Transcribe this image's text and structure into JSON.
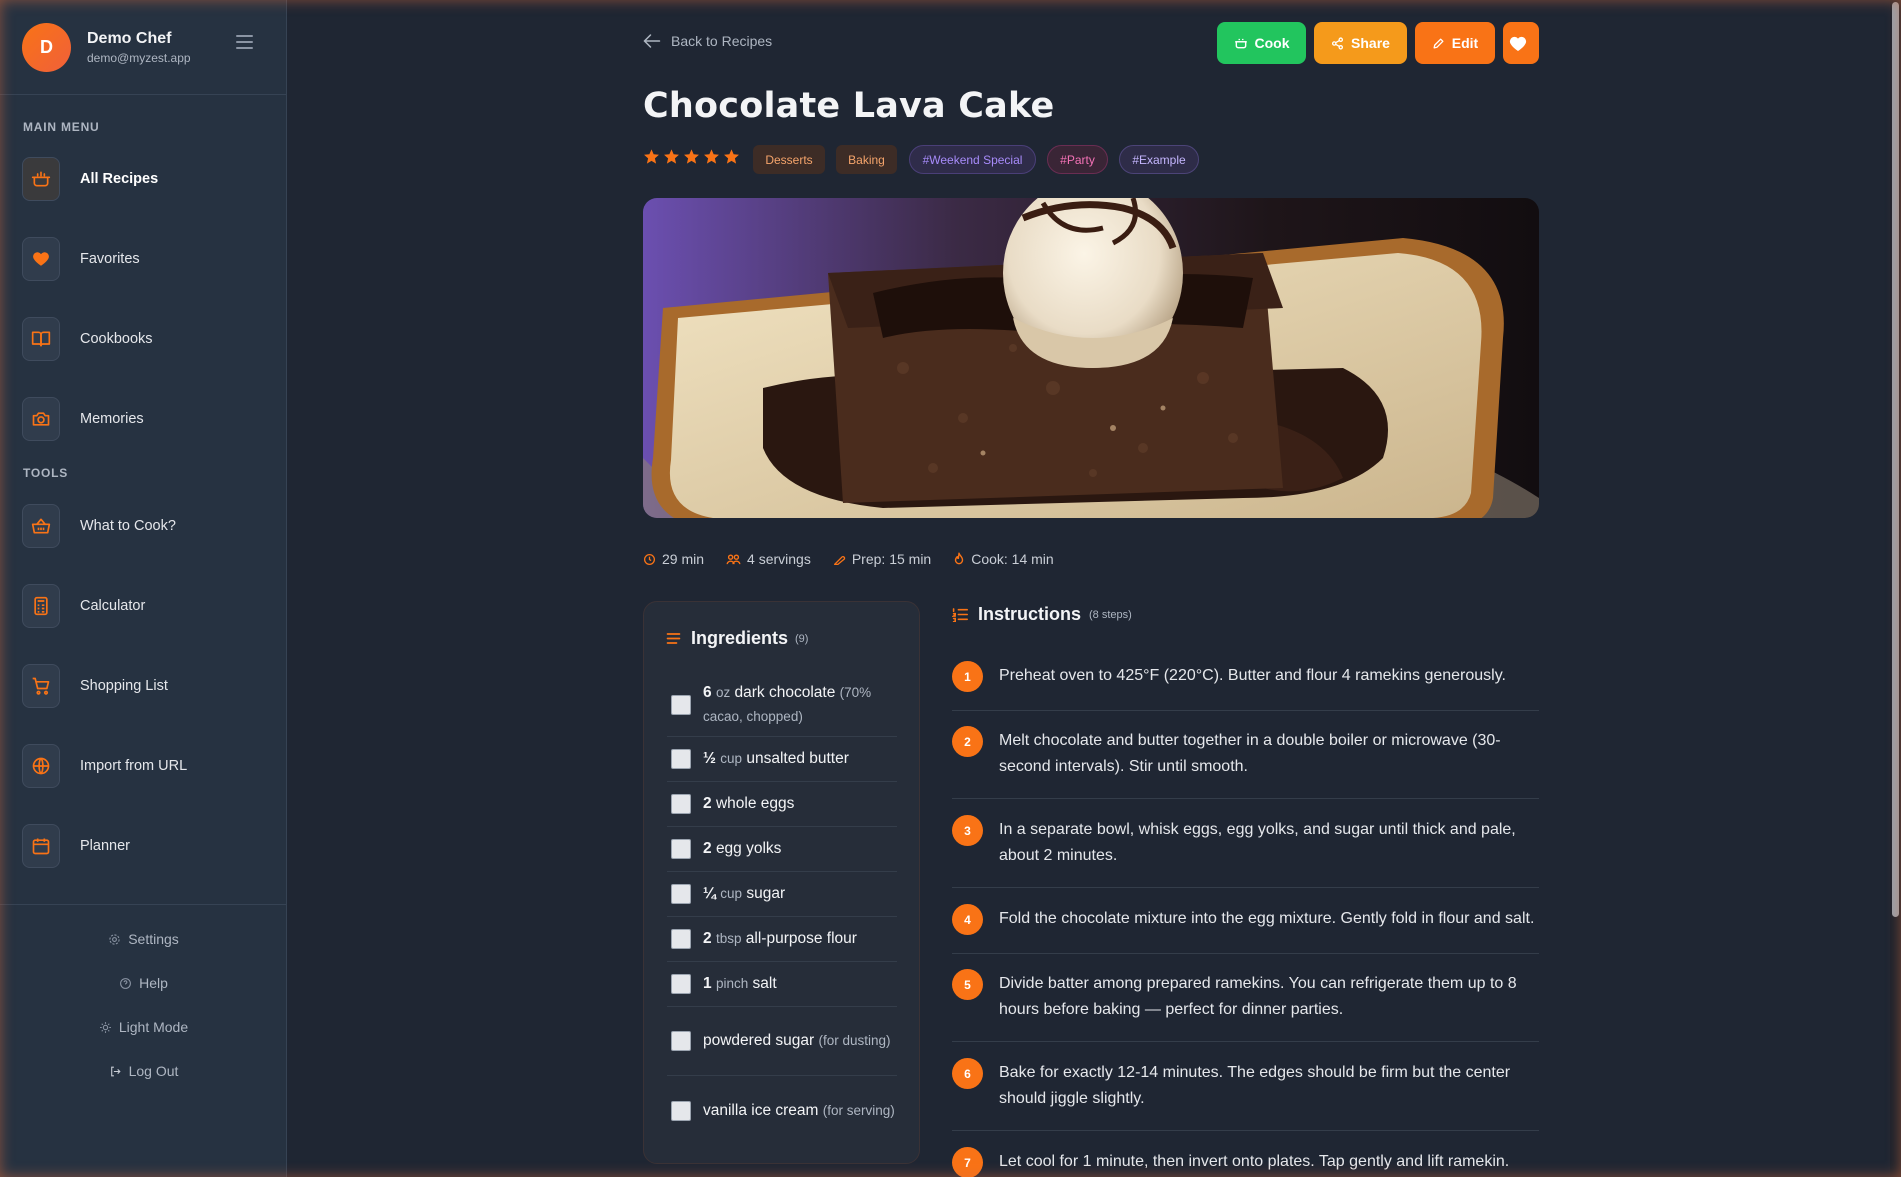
{
  "colors": {
    "accent": "#f97316",
    "cook_button": "#22c55e",
    "background": "#1f2633",
    "sidebar": "#263241"
  },
  "profile": {
    "initial": "D",
    "name": "Demo Chef",
    "email": "demo@myzest.app"
  },
  "sidebar": {
    "main_menu_label": "MAIN MENU",
    "tools_label": "TOOLS",
    "main_items": [
      {
        "label": "All Recipes",
        "icon": "pot-icon"
      },
      {
        "label": "Favorites",
        "icon": "heart-icon"
      },
      {
        "label": "Cookbooks",
        "icon": "book-icon"
      },
      {
        "label": "Memories",
        "icon": "camera-icon"
      }
    ],
    "tool_items": [
      {
        "label": "What to Cook?",
        "icon": "basket-icon"
      },
      {
        "label": "Calculator",
        "icon": "calculator-icon"
      },
      {
        "label": "Shopping List",
        "icon": "cart-icon"
      },
      {
        "label": "Import from URL",
        "icon": "globe-icon"
      },
      {
        "label": "Planner",
        "icon": "calendar-icon"
      }
    ],
    "bottom_links": {
      "settings": "Settings",
      "help": "Help",
      "light_mode": "Light Mode",
      "logout": "Log Out"
    }
  },
  "header": {
    "back_label": "Back to Recipes",
    "cook_label": "Cook",
    "share_label": "Share",
    "edit_label": "Edit"
  },
  "recipe": {
    "title": "Chocolate Lava Cake",
    "rating": 5,
    "categories": [
      "Desserts",
      "Baking"
    ],
    "hashtags": [
      {
        "label": "#Weekend Special",
        "color": "#a78bfa"
      },
      {
        "label": "#Party",
        "color": "#f472b6"
      },
      {
        "label": "#Example",
        "color": "#c4b5fd"
      }
    ],
    "meta": {
      "total_time": "29 min",
      "servings": "4 servings",
      "prep": "Prep: 15 min",
      "cook": "Cook: 14 min"
    }
  },
  "ingredients": {
    "title": "Ingredients",
    "count": "(9)",
    "items": [
      {
        "qty": "6",
        "unit": "oz",
        "name": "dark chocolate",
        "note": "(70% cacao, chopped)"
      },
      {
        "qty": "½",
        "unit": "cup",
        "name": "unsalted butter",
        "note": ""
      },
      {
        "qty": "2",
        "unit": "",
        "name": "whole eggs",
        "note": ""
      },
      {
        "qty": "2",
        "unit": "",
        "name": "egg yolks",
        "note": ""
      },
      {
        "qty": "¼",
        "unit": "cup",
        "name": "sugar",
        "note": ""
      },
      {
        "qty": "2",
        "unit": "tbsp",
        "name": "all-purpose flour",
        "note": ""
      },
      {
        "qty": "1",
        "unit": "pinch",
        "name": "salt",
        "note": ""
      },
      {
        "qty": "",
        "unit": "",
        "name": "powdered sugar",
        "note": "(for dusting)"
      },
      {
        "qty": "",
        "unit": "",
        "name": "vanilla ice cream",
        "note": "(for serving)"
      }
    ]
  },
  "instructions": {
    "title": "Instructions",
    "count": "(8 steps)",
    "steps": [
      {
        "num": "1",
        "text": "Preheat oven to 425°F (220°C). Butter and flour 4 ramekins generously."
      },
      {
        "num": "2",
        "text": "Melt chocolate and butter together in a double boiler or microwave (30-second intervals). Stir until smooth."
      },
      {
        "num": "3",
        "text": "In a separate bowl, whisk eggs, egg yolks, and sugar until thick and pale, about 2 minutes."
      },
      {
        "num": "4",
        "text": "Fold the chocolate mixture into the egg mixture. Gently fold in flour and salt."
      },
      {
        "num": "5",
        "text": "Divide batter among prepared ramekins. You can refrigerate them up to 8 hours before baking — perfect for dinner parties."
      },
      {
        "num": "6",
        "text": "Bake for exactly 12-14 minutes. The edges should be firm but the center should jiggle slightly."
      },
      {
        "num": "7",
        "text": "Let cool for 1 minute, then invert onto plates. Tap gently and lift ramekin."
      }
    ]
  }
}
